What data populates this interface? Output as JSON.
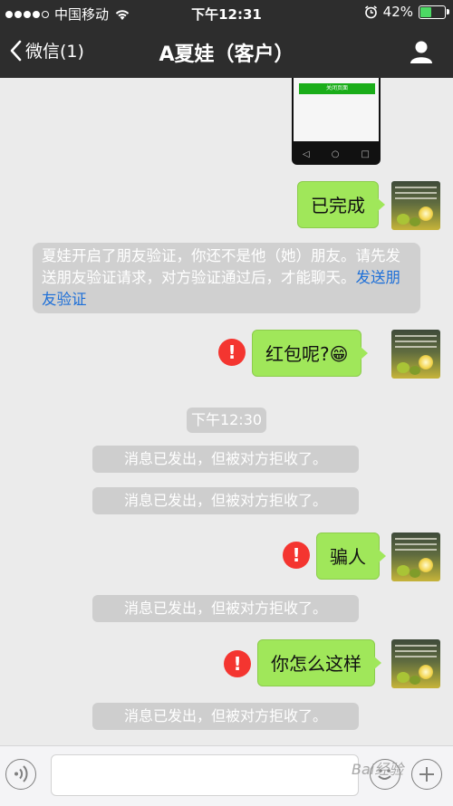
{
  "status_bar": {
    "carrier": "中国移动",
    "time": "下午12:31",
    "battery": "42%",
    "battery_level": 0.42,
    "icons": [
      "signal-dots-icon",
      "wifi-icon",
      "alarm-icon",
      "battery-icon"
    ]
  },
  "nav": {
    "back_label": "微信(1)",
    "title": "A夏娃（客户）",
    "profile_icon": "person-icon"
  },
  "screenshot_preview": {
    "button_label": "关闭页面"
  },
  "messages": [
    {
      "type": "out",
      "text": "已完成",
      "failed": false
    },
    {
      "type": "system_notice",
      "text": "夏娃开启了朋友验证，你还不是他（她）朋友。请先发送朋友验证请求，对方验证通过后，才能聊天。",
      "link": "发送朋友验证"
    },
    {
      "type": "out",
      "text": "红包呢?😁",
      "failed": true
    },
    {
      "type": "timestamp",
      "text": "下午12:30"
    },
    {
      "type": "system",
      "text": "消息已发出，但被对方拒收了。"
    },
    {
      "type": "system",
      "text": "消息已发出，但被对方拒收了。"
    },
    {
      "type": "out",
      "text": "骗人",
      "failed": true
    },
    {
      "type": "system",
      "text": "消息已发出，但被对方拒收了。"
    },
    {
      "type": "out",
      "text": "你怎么这样",
      "failed": true
    },
    {
      "type": "system",
      "text": "消息已发出，但被对方拒收了。"
    }
  ],
  "error_mark": "!",
  "input_bar": {
    "value": "",
    "watermark": "Bai经验"
  },
  "colors": {
    "nav_bg": "#2d2d2d",
    "bubble_out": "#a0e75a",
    "error_red": "#f43530",
    "link_blue": "#1d6fd8",
    "chat_bg": "#ebebeb"
  }
}
